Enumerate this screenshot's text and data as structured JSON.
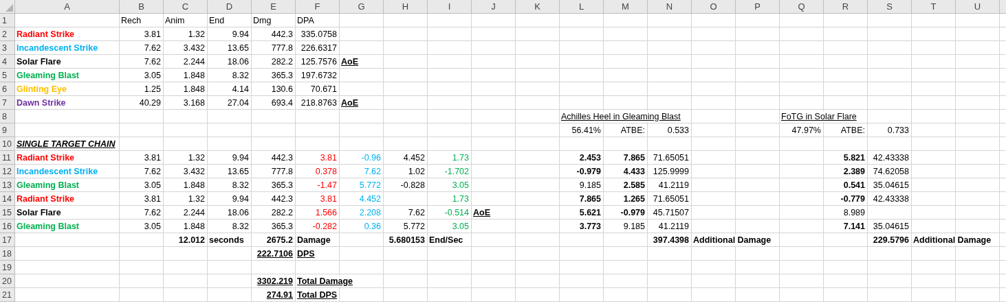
{
  "columns": [
    "A",
    "B",
    "C",
    "D",
    "E",
    "F",
    "G",
    "H",
    "I",
    "J",
    "K",
    "L",
    "M",
    "N",
    "O",
    "P",
    "Q",
    "R",
    "S",
    "T",
    "U"
  ],
  "rows": [
    {
      "number": "1",
      "cells": [
        null,
        {
          "text": "Rech",
          "right_aligned": false,
          "bold": false,
          "italic": false,
          "underline": false
        },
        {
          "text": "Anim",
          "right_aligned": false,
          "bold": false,
          "italic": false,
          "underline": false
        },
        {
          "text": "End",
          "right_aligned": false,
          "bold": false,
          "italic": false,
          "underline": false
        },
        {
          "text": "Dmg",
          "right_aligned": false,
          "bold": false,
          "italic": false,
          "underline": false
        },
        {
          "text": "DPA",
          "right_aligned": false,
          "bold": false,
          "italic": false,
          "underline": false
        }
      ]
    },
    {
      "number": "2",
      "cells": [
        {
          "text": "Radiant Strike",
          "right_aligned": false,
          "bold": true,
          "italic": false,
          "underline": false,
          "color": "#ff0000"
        },
        {
          "text": "3.81",
          "right_aligned": true,
          "bold": false,
          "italic": false,
          "underline": false
        },
        {
          "text": "1.32",
          "right_aligned": true,
          "bold": false,
          "italic": false,
          "underline": false
        },
        {
          "text": "9.94",
          "right_aligned": true,
          "bold": false,
          "italic": false,
          "underline": false
        },
        {
          "text": "442.3",
          "right_aligned": true,
          "bold": false,
          "italic": false,
          "underline": false
        },
        {
          "text": "335.0758",
          "right_aligned": true,
          "bold": false,
          "italic": false,
          "underline": false
        }
      ]
    },
    {
      "number": "3",
      "cells": [
        {
          "text": "Incandescent Strike",
          "right_aligned": false,
          "bold": true,
          "italic": false,
          "underline": false,
          "color": "#00b0f0"
        },
        {
          "text": "7.62",
          "right_aligned": true,
          "bold": false,
          "italic": false,
          "underline": false
        },
        {
          "text": "3.432",
          "right_aligned": true,
          "bold": false,
          "italic": false,
          "underline": false
        },
        {
          "text": "13.65",
          "right_aligned": true,
          "bold": false,
          "italic": false,
          "underline": false
        },
        {
          "text": "777.8",
          "right_aligned": true,
          "bold": false,
          "italic": false,
          "underline": false
        },
        {
          "text": "226.6317",
          "right_aligned": true,
          "bold": false,
          "italic": false,
          "underline": false
        }
      ]
    },
    {
      "number": "4",
      "cells": [
        {
          "text": "Solar Flare",
          "right_aligned": false,
          "bold": true,
          "italic": false,
          "underline": false
        },
        {
          "text": "7.62",
          "right_aligned": true,
          "bold": false,
          "italic": false,
          "underline": false
        },
        {
          "text": "2.244",
          "right_aligned": true,
          "bold": false,
          "italic": false,
          "underline": false
        },
        {
          "text": "18.06",
          "right_aligned": true,
          "bold": false,
          "italic": false,
          "underline": false
        },
        {
          "text": "282.2",
          "right_aligned": true,
          "bold": false,
          "italic": false,
          "underline": false
        },
        {
          "text": "125.7576",
          "right_aligned": true,
          "bold": false,
          "italic": false,
          "underline": false
        },
        {
          "text": "AoE",
          "right_aligned": false,
          "bold": true,
          "italic": false,
          "underline": true
        }
      ]
    },
    {
      "number": "5",
      "cells": [
        {
          "text": "Gleaming Blast",
          "right_aligned": false,
          "bold": true,
          "italic": false,
          "underline": false,
          "color": "#00b050"
        },
        {
          "text": "3.05",
          "right_aligned": true,
          "bold": false,
          "italic": false,
          "underline": false
        },
        {
          "text": "1.848",
          "right_aligned": true,
          "bold": false,
          "italic": false,
          "underline": false
        },
        {
          "text": "8.32",
          "right_aligned": true,
          "bold": false,
          "italic": false,
          "underline": false
        },
        {
          "text": "365.3",
          "right_aligned": true,
          "bold": false,
          "italic": false,
          "underline": false
        },
        {
          "text": "197.6732",
          "right_aligned": true,
          "bold": false,
          "italic": false,
          "underline": false
        }
      ]
    },
    {
      "number": "6",
      "cells": [
        {
          "text": "Glinting Eye",
          "right_aligned": false,
          "bold": true,
          "italic": false,
          "underline": false,
          "color": "#ffc000"
        },
        {
          "text": "1.25",
          "right_aligned": true,
          "bold": false,
          "italic": false,
          "underline": false
        },
        {
          "text": "1.848",
          "right_aligned": true,
          "bold": false,
          "italic": false,
          "underline": false
        },
        {
          "text": "4.14",
          "right_aligned": true,
          "bold": false,
          "italic": false,
          "underline": false
        },
        {
          "text": "130.6",
          "right_aligned": true,
          "bold": false,
          "italic": false,
          "underline": false
        },
        {
          "text": "70.671",
          "right_aligned": true,
          "bold": false,
          "italic": false,
          "underline": false
        }
      ]
    },
    {
      "number": "7",
      "cells": [
        {
          "text": "Dawn Strike",
          "right_aligned": false,
          "bold": true,
          "italic": false,
          "underline": false,
          "color": "#7030a0"
        },
        {
          "text": "40.29",
          "right_aligned": true,
          "bold": false,
          "italic": false,
          "underline": false
        },
        {
          "text": "3.168",
          "right_aligned": true,
          "bold": false,
          "italic": false,
          "underline": false
        },
        {
          "text": "27.04",
          "right_aligned": true,
          "bold": false,
          "italic": false,
          "underline": false
        },
        {
          "text": "693.4",
          "right_aligned": true,
          "bold": false,
          "italic": false,
          "underline": false
        },
        {
          "text": "218.8763",
          "right_aligned": true,
          "bold": false,
          "italic": false,
          "underline": false
        },
        {
          "text": "AoE",
          "right_aligned": false,
          "bold": true,
          "italic": false,
          "underline": true
        }
      ]
    },
    {
      "number": "8",
      "cells": [
        null,
        null,
        null,
        null,
        null,
        null,
        null,
        null,
        null,
        null,
        null,
        {
          "text": "Achilles Heel in Gleaming Blast",
          "right_aligned": false,
          "bold": false,
          "italic": false,
          "underline": true
        },
        null,
        null,
        null,
        null,
        {
          "text": "FoTG in Solar Flare",
          "right_aligned": false,
          "bold": false,
          "italic": false,
          "underline": true
        }
      ]
    },
    {
      "number": "9",
      "cells": [
        null,
        null,
        null,
        null,
        null,
        null,
        null,
        null,
        null,
        null,
        null,
        {
          "text": "56.41%",
          "right_aligned": true,
          "bold": false,
          "italic": false,
          "underline": false
        },
        {
          "text": "ATBE:",
          "right_aligned": true,
          "bold": false,
          "italic": false,
          "underline": false
        },
        {
          "text": "0.533",
          "right_aligned": true,
          "bold": false,
          "italic": false,
          "underline": false
        },
        null,
        null,
        {
          "text": "47.97%",
          "right_aligned": true,
          "bold": false,
          "italic": false,
          "underline": false
        },
        {
          "text": "ATBE:",
          "right_aligned": true,
          "bold": false,
          "italic": false,
          "underline": false
        },
        {
          "text": "0.733",
          "right_aligned": true,
          "bold": false,
          "italic": false,
          "underline": false
        }
      ]
    },
    {
      "number": "10",
      "cells": [
        {
          "text": "SINGLE TARGET CHAIN",
          "right_aligned": false,
          "bold": true,
          "italic": true,
          "underline": true
        }
      ]
    },
    {
      "number": "11",
      "cells": [
        {
          "text": "Radiant Strike",
          "right_aligned": false,
          "bold": true,
          "italic": false,
          "underline": false,
          "color": "#ff0000"
        },
        {
          "text": "3.81",
          "right_aligned": true,
          "bold": false,
          "italic": false,
          "underline": false
        },
        {
          "text": "1.32",
          "right_aligned": true,
          "bold": false,
          "italic": false,
          "underline": false
        },
        {
          "text": "9.94",
          "right_aligned": true,
          "bold": false,
          "italic": false,
          "underline": false
        },
        {
          "text": "442.3",
          "right_aligned": true,
          "bold": false,
          "italic": false,
          "underline": false
        },
        {
          "text": "3.81",
          "right_aligned": true,
          "bold": false,
          "italic": false,
          "underline": false,
          "color": "#ff0000"
        },
        {
          "text": "-0.96",
          "right_aligned": true,
          "bold": false,
          "italic": false,
          "underline": false,
          "color": "#00b0f0"
        },
        {
          "text": "4.452",
          "right_aligned": true,
          "bold": false,
          "italic": false,
          "underline": false
        },
        {
          "text": "1.73",
          "right_aligned": true,
          "bold": false,
          "italic": false,
          "underline": false,
          "color": "#00b050"
        },
        null,
        null,
        {
          "text": "2.453",
          "right_aligned": true,
          "bold": true,
          "italic": false,
          "underline": false
        },
        {
          "text": "7.865",
          "right_aligned": true,
          "bold": true,
          "italic": false,
          "underline": false
        },
        {
          "text": "71.65051",
          "right_aligned": true,
          "bold": false,
          "italic": false,
          "underline": false
        },
        null,
        null,
        null,
        {
          "text": "5.821",
          "right_aligned": true,
          "bold": true,
          "italic": false,
          "underline": false
        },
        {
          "text": "42.43338",
          "right_aligned": true,
          "bold": false,
          "italic": false,
          "underline": false
        }
      ]
    },
    {
      "number": "12",
      "cells": [
        {
          "text": "Incandescent Strike",
          "right_aligned": false,
          "bold": true,
          "italic": false,
          "underline": false,
          "color": "#00b0f0"
        },
        {
          "text": "7.62",
          "right_aligned": true,
          "bold": false,
          "italic": false,
          "underline": false
        },
        {
          "text": "3.432",
          "right_aligned": true,
          "bold": false,
          "italic": false,
          "underline": false
        },
        {
          "text": "13.65",
          "right_aligned": true,
          "bold": false,
          "italic": false,
          "underline": false
        },
        {
          "text": "777.8",
          "right_aligned": true,
          "bold": false,
          "italic": false,
          "underline": false
        },
        {
          "text": "0.378",
          "right_aligned": true,
          "bold": false,
          "italic": false,
          "underline": false,
          "color": "#ff0000"
        },
        {
          "text": "7.62",
          "right_aligned": true,
          "bold": false,
          "italic": false,
          "underline": false,
          "color": "#00b0f0"
        },
        {
          "text": "1.02",
          "right_aligned": true,
          "bold": false,
          "italic": false,
          "underline": false
        },
        {
          "text": "-1.702",
          "right_aligned": true,
          "bold": false,
          "italic": false,
          "underline": false,
          "color": "#00b050"
        },
        null,
        null,
        {
          "text": "-0.979",
          "right_aligned": true,
          "bold": true,
          "italic": false,
          "underline": false
        },
        {
          "text": "4.433",
          "right_aligned": true,
          "bold": true,
          "italic": false,
          "underline": false
        },
        {
          "text": "125.9999",
          "right_aligned": true,
          "bold": false,
          "italic": false,
          "underline": false
        },
        null,
        null,
        null,
        {
          "text": "2.389",
          "right_aligned": true,
          "bold": true,
          "italic": false,
          "underline": false
        },
        {
          "text": "74.62058",
          "right_aligned": true,
          "bold": false,
          "italic": false,
          "underline": false
        }
      ]
    },
    {
      "number": "13",
      "cells": [
        {
          "text": "Gleaming Blast",
          "right_aligned": false,
          "bold": true,
          "italic": false,
          "underline": false,
          "color": "#00b050"
        },
        {
          "text": "3.05",
          "right_aligned": true,
          "bold": false,
          "italic": false,
          "underline": false
        },
        {
          "text": "1.848",
          "right_aligned": true,
          "bold": false,
          "italic": false,
          "underline": false
        },
        {
          "text": "8.32",
          "right_aligned": true,
          "bold": false,
          "italic": false,
          "underline": false
        },
        {
          "text": "365.3",
          "right_aligned": true,
          "bold": false,
          "italic": false,
          "underline": false
        },
        {
          "text": "-1.47",
          "right_aligned": true,
          "bold": false,
          "italic": false,
          "underline": false,
          "color": "#ff0000"
        },
        {
          "text": "5.772",
          "right_aligned": true,
          "bold": false,
          "italic": false,
          "underline": false,
          "color": "#00b0f0"
        },
        {
          "text": "-0.828",
          "right_aligned": true,
          "bold": false,
          "italic": false,
          "underline": false
        },
        {
          "text": "3.05",
          "right_aligned": true,
          "bold": false,
          "italic": false,
          "underline": false,
          "color": "#00b050"
        },
        null,
        null,
        {
          "text": "9.185",
          "right_aligned": true,
          "bold": false,
          "italic": false,
          "underline": false
        },
        {
          "text": "2.585",
          "right_aligned": true,
          "bold": true,
          "italic": false,
          "underline": false
        },
        {
          "text": "41.2119",
          "right_aligned": true,
          "bold": false,
          "italic": false,
          "underline": false
        },
        null,
        null,
        null,
        {
          "text": "0.541",
          "right_aligned": true,
          "bold": true,
          "italic": false,
          "underline": false
        },
        {
          "text": "35.04615",
          "right_aligned": true,
          "bold": false,
          "italic": false,
          "underline": false
        }
      ]
    },
    {
      "number": "14",
      "cells": [
        {
          "text": "Radiant Strike",
          "right_aligned": false,
          "bold": true,
          "italic": false,
          "underline": false,
          "color": "#ff0000"
        },
        {
          "text": "3.81",
          "right_aligned": true,
          "bold": false,
          "italic": false,
          "underline": false
        },
        {
          "text": "1.32",
          "right_aligned": true,
          "bold": false,
          "italic": false,
          "underline": false
        },
        {
          "text": "9.94",
          "right_aligned": true,
          "bold": false,
          "italic": false,
          "underline": false
        },
        {
          "text": "442.3",
          "right_aligned": true,
          "bold": false,
          "italic": false,
          "underline": false
        },
        {
          "text": "3.81",
          "right_aligned": true,
          "bold": false,
          "italic": false,
          "underline": false,
          "color": "#ff0000"
        },
        {
          "text": "4.452",
          "right_aligned": true,
          "bold": false,
          "italic": false,
          "underline": false,
          "color": "#00b0f0"
        },
        null,
        {
          "text": "1.73",
          "right_aligned": true,
          "bold": false,
          "italic": false,
          "underline": false,
          "color": "#00b050"
        },
        null,
        null,
        {
          "text": "7.865",
          "right_aligned": true,
          "bold": true,
          "italic": false,
          "underline": false
        },
        {
          "text": "1.265",
          "right_aligned": true,
          "bold": true,
          "italic": false,
          "underline": false
        },
        {
          "text": "71.65051",
          "right_aligned": true,
          "bold": false,
          "italic": false,
          "underline": false
        },
        null,
        null,
        null,
        {
          "text": "-0.779",
          "right_aligned": true,
          "bold": true,
          "italic": false,
          "underline": false
        },
        {
          "text": "42.43338",
          "right_aligned": true,
          "bold": false,
          "italic": false,
          "underline": false
        }
      ]
    },
    {
      "number": "15",
      "cells": [
        {
          "text": "Solar Flare",
          "right_aligned": false,
          "bold": true,
          "italic": false,
          "underline": false
        },
        {
          "text": "7.62",
          "right_aligned": true,
          "bold": false,
          "italic": false,
          "underline": false
        },
        {
          "text": "2.244",
          "right_aligned": true,
          "bold": false,
          "italic": false,
          "underline": false
        },
        {
          "text": "18.06",
          "right_aligned": true,
          "bold": false,
          "italic": false,
          "underline": false
        },
        {
          "text": "282.2",
          "right_aligned": true,
          "bold": false,
          "italic": false,
          "underline": false
        },
        {
          "text": "1.566",
          "right_aligned": true,
          "bold": false,
          "italic": false,
          "underline": false,
          "color": "#ff0000"
        },
        {
          "text": "2.208",
          "right_aligned": true,
          "bold": false,
          "italic": false,
          "underline": false,
          "color": "#00b0f0"
        },
        {
          "text": "7.62",
          "right_aligned": true,
          "bold": false,
          "italic": false,
          "underline": false
        },
        {
          "text": "-0.514",
          "right_aligned": true,
          "bold": false,
          "italic": false,
          "underline": false,
          "color": "#00b050"
        },
        {
          "text": "AoE",
          "right_aligned": false,
          "bold": true,
          "italic": false,
          "underline": true
        },
        null,
        {
          "text": "5.621",
          "right_aligned": true,
          "bold": true,
          "italic": false,
          "underline": false
        },
        {
          "text": "-0.979",
          "right_aligned": true,
          "bold": true,
          "italic": false,
          "underline": false
        },
        {
          "text": "45.71507",
          "right_aligned": true,
          "bold": false,
          "italic": false,
          "underline": false
        },
        null,
        null,
        null,
        {
          "text": "8.989",
          "right_aligned": true,
          "bold": false,
          "italic": false,
          "underline": false
        }
      ]
    },
    {
      "number": "16",
      "cells": [
        {
          "text": "Gleaming Blast",
          "right_aligned": false,
          "bold": true,
          "italic": false,
          "underline": false,
          "color": "#00b050"
        },
        {
          "text": "3.05",
          "right_aligned": true,
          "bold": false,
          "italic": false,
          "underline": false
        },
        {
          "text": "1.848",
          "right_aligned": true,
          "bold": false,
          "italic": false,
          "underline": false
        },
        {
          "text": "8.32",
          "right_aligned": true,
          "bold": false,
          "italic": false,
          "underline": false
        },
        {
          "text": "365.3",
          "right_aligned": true,
          "bold": false,
          "italic": false,
          "underline": false
        },
        {
          "text": "-0.282",
          "right_aligned": true,
          "bold": false,
          "italic": false,
          "underline": false,
          "color": "#ff0000"
        },
        {
          "text": "0.36",
          "right_aligned": true,
          "bold": false,
          "italic": false,
          "underline": false,
          "color": "#00b0f0"
        },
        {
          "text": "5.772",
          "right_aligned": true,
          "bold": false,
          "italic": false,
          "underline": false
        },
        {
          "text": "3.05",
          "right_aligned": true,
          "bold": false,
          "italic": false,
          "underline": false,
          "color": "#00b050"
        },
        null,
        null,
        {
          "text": "3.773",
          "right_aligned": true,
          "bold": true,
          "italic": false,
          "underline": false
        },
        {
          "text": "9.185",
          "right_aligned": true,
          "bold": false,
          "italic": false,
          "underline": false
        },
        {
          "text": "41.2119",
          "right_aligned": true,
          "bold": false,
          "italic": false,
          "underline": false
        },
        null,
        null,
        null,
        {
          "text": "7.141",
          "right_aligned": true,
          "bold": true,
          "italic": false,
          "underline": false
        },
        {
          "text": "35.04615",
          "right_aligned": true,
          "bold": false,
          "italic": false,
          "underline": false
        }
      ]
    },
    {
      "number": "17",
      "cells": [
        null,
        null,
        {
          "text": "12.012",
          "right_aligned": true,
          "bold": true,
          "italic": false,
          "underline": false
        },
        {
          "text": "seconds",
          "right_aligned": false,
          "bold": true,
          "italic": false,
          "underline": false
        },
        {
          "text": "2675.2",
          "right_aligned": true,
          "bold": true,
          "italic": false,
          "underline": false
        },
        {
          "text": "Damage",
          "right_aligned": false,
          "bold": true,
          "italic": false,
          "underline": false
        },
        null,
        {
          "text": "5.680153",
          "right_aligned": true,
          "bold": true,
          "italic": false,
          "underline": false
        },
        {
          "text": "End/Sec",
          "right_aligned": false,
          "bold": true,
          "italic": false,
          "underline": false
        },
        null,
        null,
        null,
        null,
        {
          "text": "397.4398",
          "right_aligned": true,
          "bold": true,
          "italic": false,
          "underline": false
        },
        {
          "text": "Additional Damage",
          "right_aligned": false,
          "bold": true,
          "italic": false,
          "underline": false
        },
        null,
        null,
        null,
        {
          "text": "229.5796",
          "right_aligned": true,
          "bold": true,
          "italic": false,
          "underline": false
        },
        {
          "text": "Additional Damage",
          "right_aligned": false,
          "bold": true,
          "italic": false,
          "underline": false
        }
      ]
    },
    {
      "number": "18",
      "cells": [
        null,
        null,
        null,
        null,
        {
          "text": "222.7106",
          "right_aligned": true,
          "bold": true,
          "italic": false,
          "underline": true
        },
        {
          "text": "DPS",
          "right_aligned": false,
          "bold": true,
          "italic": false,
          "underline": true
        }
      ]
    },
    {
      "number": "19"
    },
    {
      "number": "20",
      "cells": [
        null,
        null,
        null,
        null,
        {
          "text": "3302.219",
          "right_aligned": true,
          "bold": true,
          "italic": false,
          "underline": true
        },
        {
          "text": "Total Damage",
          "right_aligned": false,
          "bold": true,
          "italic": false,
          "underline": true
        }
      ]
    },
    {
      "number": "21",
      "cells": [
        null,
        null,
        null,
        null,
        {
          "text": "274.91",
          "right_aligned": true,
          "bold": true,
          "italic": false,
          "underline": true
        },
        {
          "text": "Total DPS",
          "right_aligned": false,
          "bold": true,
          "italic": false,
          "underline": true
        }
      ]
    }
  ]
}
